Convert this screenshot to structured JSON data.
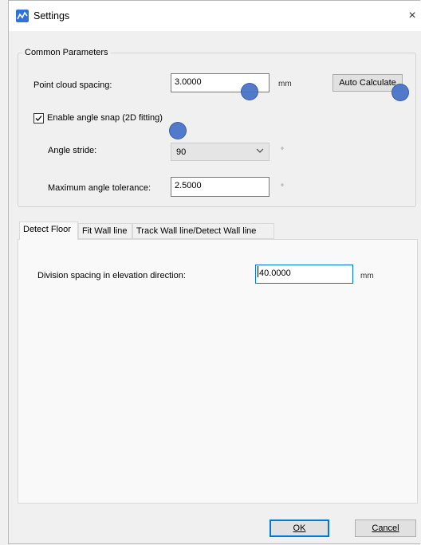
{
  "window": {
    "title": "Settings",
    "close_glyph": "×",
    "icon": "settings-app-icon"
  },
  "common": {
    "group_title": "Common Parameters",
    "point_cloud_spacing_label": "Point cloud spacing:",
    "point_cloud_spacing_value": "3.0000",
    "point_cloud_spacing_unit": "mm",
    "auto_calculate_label": "Auto Calculate",
    "enable_angle_snap_label": "Enable angle snap (2D fitting)",
    "enable_angle_snap_checked": true,
    "angle_stride_label": "Angle stride:",
    "angle_stride_value": "90",
    "angle_stride_unit": "°",
    "max_angle_tolerance_label": "Maximum angle tolerance:",
    "max_angle_tolerance_value": "2.5000",
    "max_angle_tolerance_unit": "°"
  },
  "tabs": [
    {
      "label": "Detect Floor",
      "active": true
    },
    {
      "label": "Fit Wall line",
      "active": false
    },
    {
      "label": "Track Wall line/Detect Wall line",
      "active": false
    }
  ],
  "detect_floor": {
    "division_spacing_label": "Division spacing in elevation direction:",
    "division_spacing_value": "40.0000",
    "division_spacing_unit": "mm"
  },
  "footer": {
    "ok_label": "OK",
    "cancel_label": "Cancel"
  },
  "colors": {
    "accent": "#0078d7",
    "marker": "#4a74c8"
  }
}
